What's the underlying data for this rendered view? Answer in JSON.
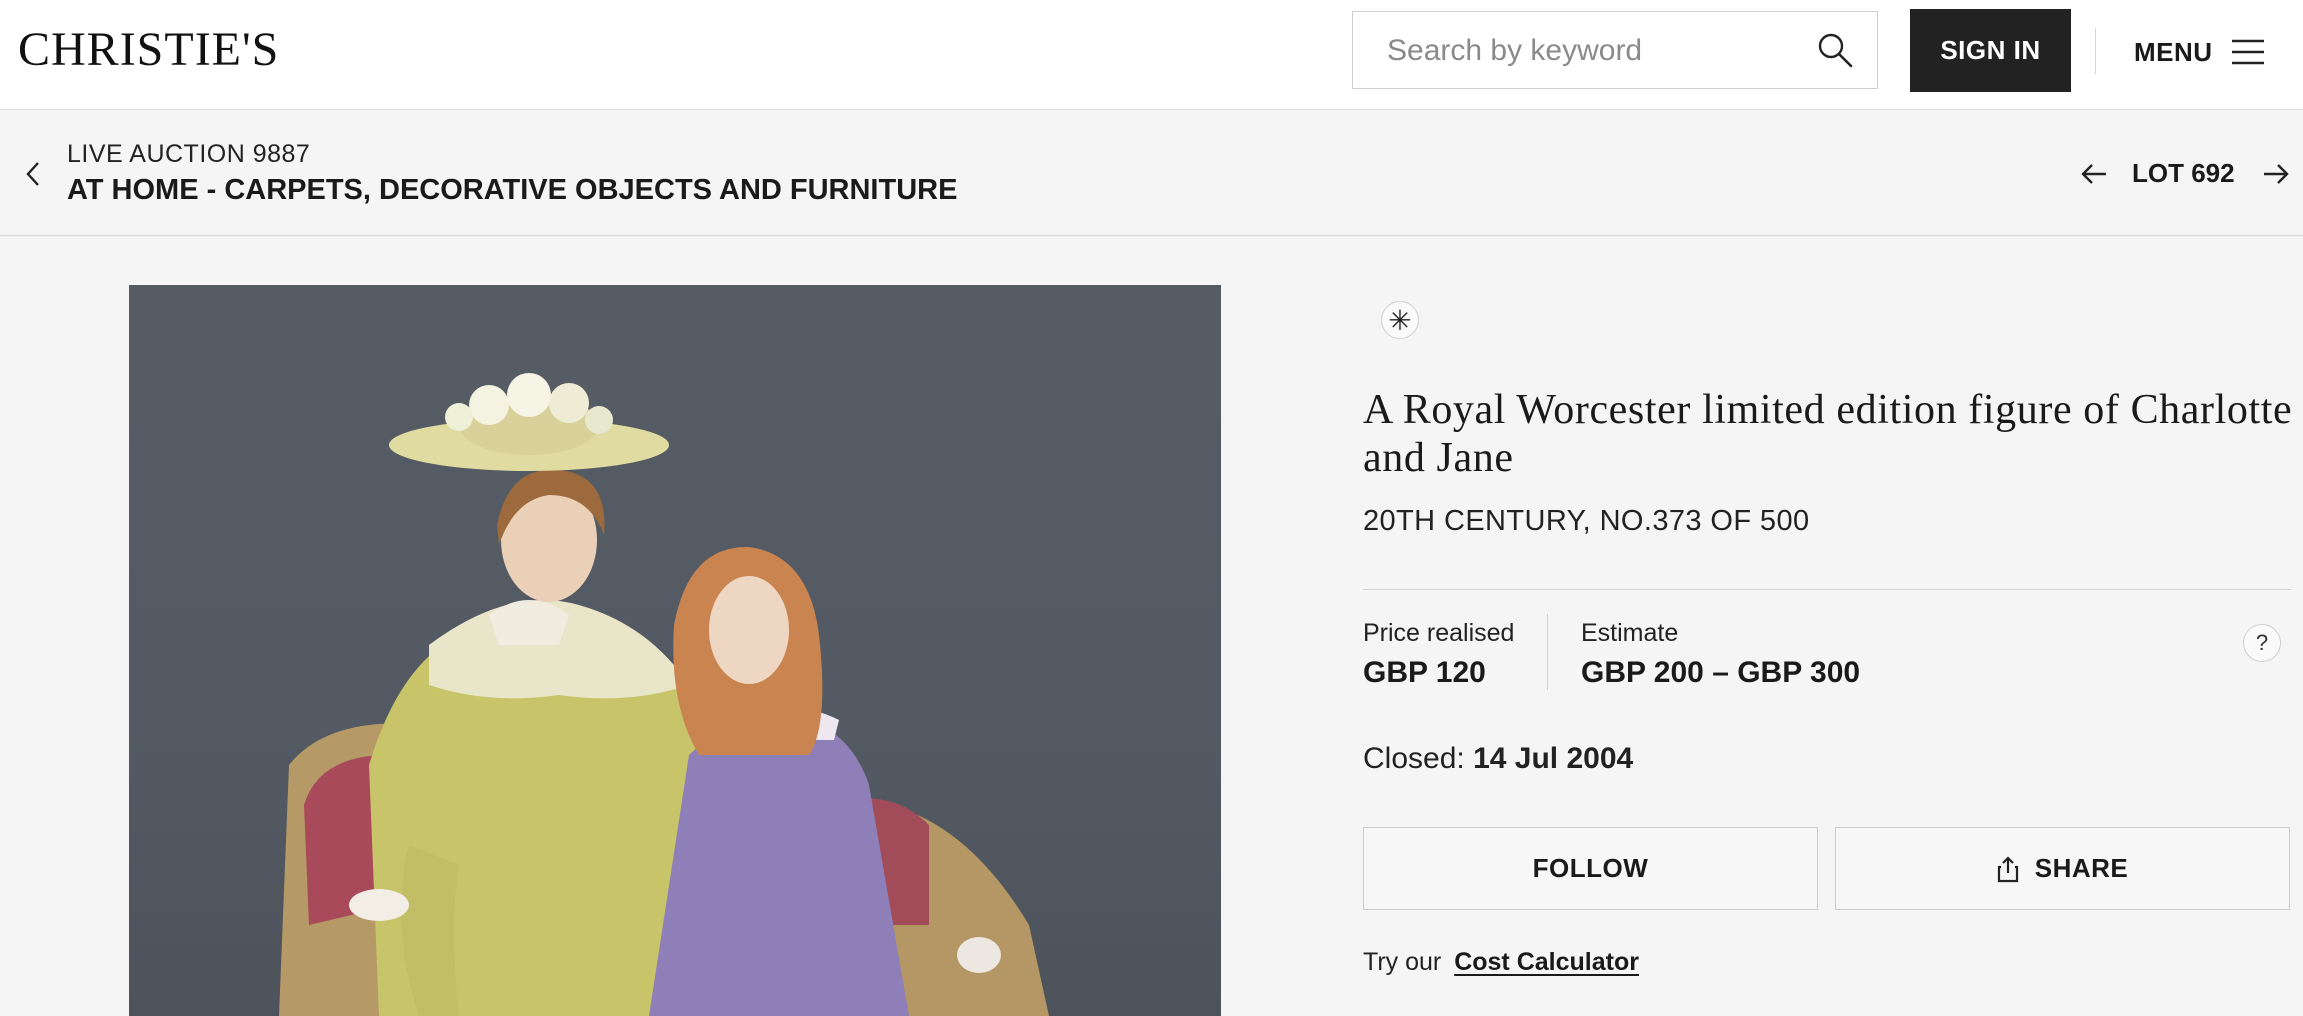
{
  "header": {
    "logo": "CHRISTIE'S",
    "search_placeholder": "Search by keyword",
    "sign_in_label": "SIGN IN",
    "menu_label": "MENU"
  },
  "auction_bar": {
    "eyebrow": "LIVE AUCTION 9887",
    "title": "AT HOME - CARPETS, DECORATIVE OBJECTS AND FURNITURE",
    "lot_label": "LOT 692"
  },
  "lot": {
    "badge_symbol": "✳",
    "title": "A Royal Worcester limited edition figure of Charlotte and Jane",
    "subtitle": "20TH CENTURY, NO.373 OF 500",
    "price_label": "Price realised",
    "price_value": "GBP 120",
    "estimate_label": "Estimate",
    "estimate_value": "GBP 200 – GBP 300",
    "help_symbol": "?",
    "closed_label": "Closed:",
    "closed_date": "14 Jul 2004",
    "follow_label": "FOLLOW",
    "share_label": "SHARE",
    "cost_prefix": "Try our",
    "cost_link": "Cost Calculator"
  }
}
